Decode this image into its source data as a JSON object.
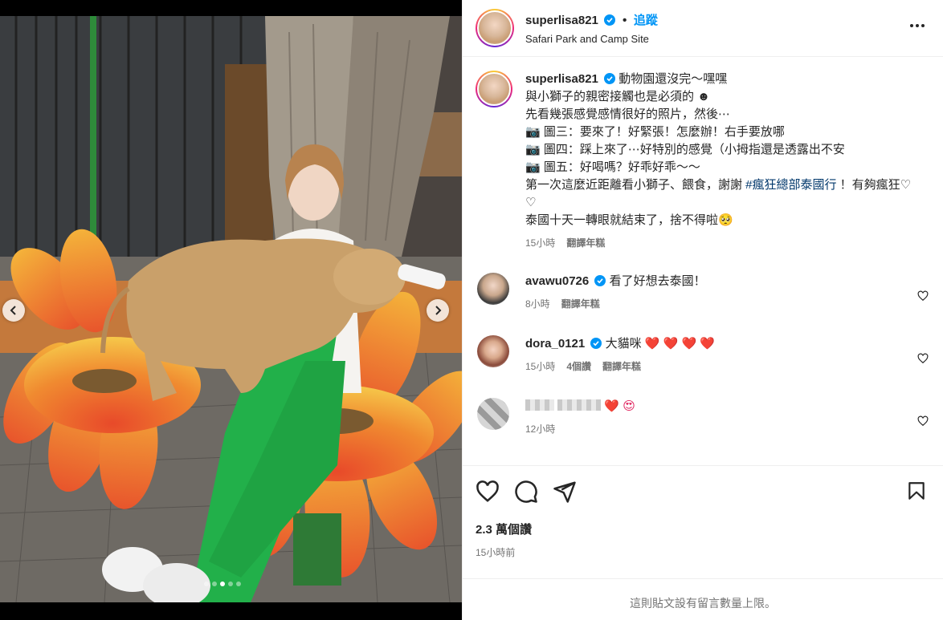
{
  "post": {
    "author": "superlisa821",
    "follow_label": "追蹤",
    "separator": "•",
    "location": "Safari Park and Camp Site"
  },
  "caption": {
    "author": "superlisa821",
    "line1": "動物園還沒完～嘿嘿",
    "line2": "與小獅子的親密接觸也是必須的 ☻",
    "line3": "先看幾張感覺感情很好的照片，然後⋯",
    "line4": "📷 圖三：要來了！好緊張！怎麼辦！右手要放哪",
    "line5": "📷 圖四：踩上來了⋯好特別的感覺（小拇指還是透露出不安",
    "line6": "📷 圖五：好喝嗎？好乖好乖～～",
    "line7a": "第一次這麼近距離看小獅子、餵食，謝謝 ",
    "hashtag": "#瘋狂總部泰國行",
    "line7b": " ！有夠瘋狂♡ ♡",
    "line8": "泰國十天一轉眼就結束了，捨不得啦🥺",
    "time": "15小時",
    "translate": "翻譯年糕"
  },
  "comments": [
    {
      "user": "avawu0726",
      "text": "看了好想去泰國！",
      "time": "8小時",
      "translate": "翻譯年糕"
    },
    {
      "user": "dora_0121",
      "text": "大貓咪",
      "hearts": "❤️ ❤️ ❤️ ❤️",
      "time": "15小時",
      "replies": "4個讚",
      "translate": "翻譯年糕"
    },
    {
      "user": "",
      "emoji": "❤️ 😍",
      "time": "12小時"
    }
  ],
  "footer": {
    "likes": "2.3 萬個讚",
    "time": "15小時前",
    "comments_closed": "這則貼文設有留言數量上限。"
  },
  "media": {
    "slide_count": 5,
    "active_slide": 3
  },
  "icons": [
    "verified-icon",
    "more-icon",
    "heart-icon",
    "comment-icon",
    "share-icon",
    "bookmark-icon",
    "chevron-left-icon",
    "chevron-right-icon"
  ],
  "colors": {
    "link": "#0095f6",
    "hashtag": "#00376b",
    "verified": "#0095f6",
    "muted": "#737373"
  }
}
